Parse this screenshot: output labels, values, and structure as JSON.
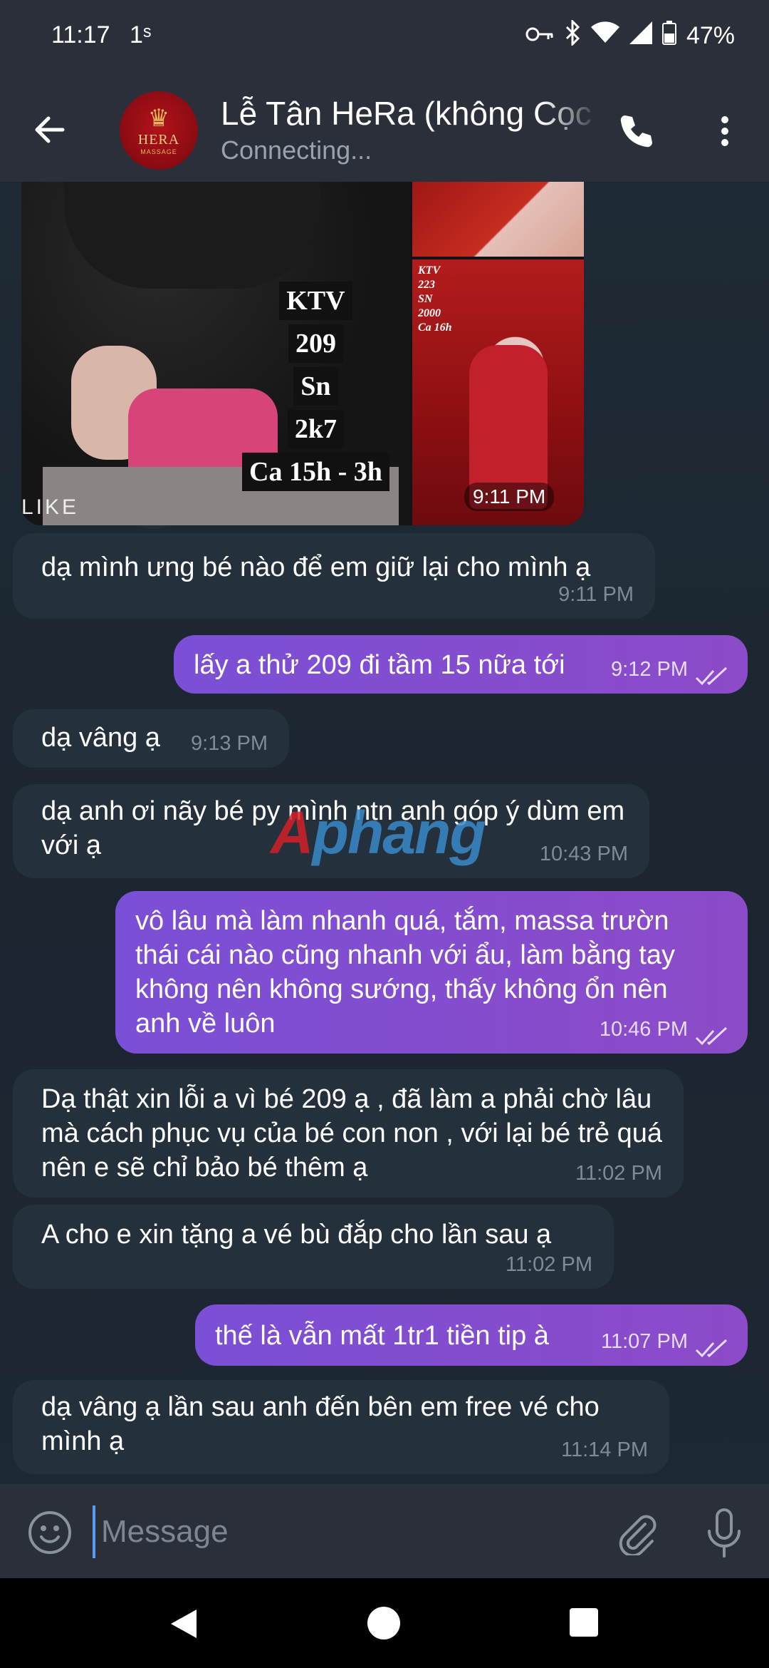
{
  "status_bar": {
    "time": "11:17",
    "extra": "1ˢ",
    "battery": "47%",
    "icons": [
      "key-icon",
      "bluetooth-icon",
      "wifi-icon",
      "cellular-icon",
      "battery-icon"
    ]
  },
  "header": {
    "title": "Lễ Tân HeRa (không Cọc",
    "subtitle": "Connecting...",
    "avatar": {
      "brand": "HERA",
      "sub": "MASSAGE"
    }
  },
  "media": {
    "main_tags": [
      "KTV",
      "209",
      "Sn",
      "2k7",
      "Ca 15h - 3h"
    ],
    "main_brand": "LIKE",
    "side_tags": [
      "KTV",
      "223",
      "SN",
      "2000",
      "Ca 16h"
    ],
    "time": "9:11 PM"
  },
  "messages": [
    {
      "dir": "in",
      "text": "dạ mình ưng bé nào để em giữ lại cho mình ạ",
      "time": "9:11 PM"
    },
    {
      "dir": "out",
      "text": "lấy a thử 209 đi tầm 15 nữa tới",
      "time": "9:12 PM"
    },
    {
      "dir": "in",
      "text": "dạ vâng ạ",
      "time": "9:13 PM"
    },
    {
      "dir": "in",
      "text": "dạ anh ơi nãy bé py mình ntn anh góp ý dùm em với ạ",
      "time": "10:43 PM"
    },
    {
      "dir": "out",
      "text": "vô lâu mà làm nhanh quá, tắm, massa trườn thái cái nào cũng nhanh với ẩu, làm bằng tay không nên không sướng, thấy không ổn nên anh về luôn",
      "time": "10:46 PM"
    },
    {
      "dir": "in",
      "text": "Dạ thật xin lỗi a vì bé 209 ạ , đã làm a phải chờ lâu mà cách phục vụ của bé con non , với lại bé trẻ quá nên e sẽ chỉ bảo bé thêm ạ",
      "time": "11:02 PM"
    },
    {
      "dir": "in",
      "text": "A cho e xin tặng a vé bù đắp cho lần sau ạ",
      "time": "11:02 PM"
    },
    {
      "dir": "out",
      "text": "thế là vẫn mất 1tr1 tiền tip à",
      "time": "11:07 PM"
    },
    {
      "dir": "in",
      "text": "dạ vâng ạ lần sau anh đến bên em free vé cho mình ạ",
      "time": "11:14 PM"
    }
  ],
  "watermark": {
    "part1": "A",
    "part2": "phang"
  },
  "composer": {
    "placeholder": "Message"
  },
  "colors": {
    "outgoing": "#8a4ccb",
    "incoming": "#24303c",
    "bar": "#2b2f3a",
    "accent": "#5a9cf0"
  }
}
